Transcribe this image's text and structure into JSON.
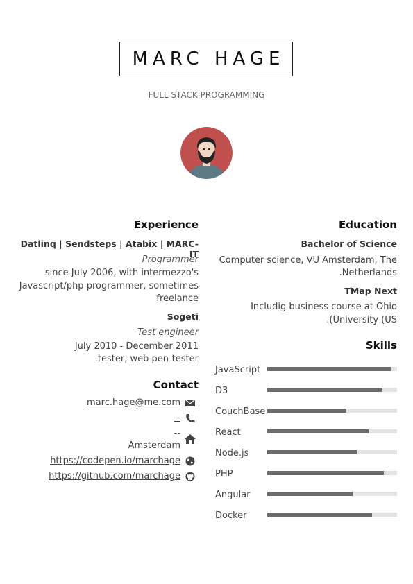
{
  "header": {
    "name": "MARC HAGE",
    "subtitle": "FULL STACK PROGRAMMING"
  },
  "experience": {
    "heading": "Experience",
    "jobs": [
      {
        "company": "Datlinq | Sendsteps | Atabix | MARC-IT",
        "role": "Programmer",
        "lines": [
          "since July 2006, with intermezzo's",
          "Javascript/php programmer, sometimes",
          "freelance"
        ]
      },
      {
        "company": "Sogeti",
        "role": "Test engineer",
        "lines": [
          "July 2010 - December 2011",
          ".tester, web pen-tester"
        ]
      }
    ]
  },
  "contact": {
    "heading": "Contact",
    "email": "marc.hage@me.com",
    "phone": "--",
    "address_line1": "--",
    "address_line2": "Amsterdam",
    "codepen": "https://codepen.io/marchage",
    "github": "https://github.com/marchage"
  },
  "education": {
    "heading": "Education",
    "items": [
      {
        "title": "Bachelor of Science",
        "lines": [
          "Computer science, VU Amsterdam, The",
          ".Netherlands"
        ]
      },
      {
        "title": "TMap Next",
        "lines": [
          "Includig business course at Ohio",
          ".(University (US"
        ]
      }
    ]
  },
  "skills": {
    "heading": "Skills",
    "items": [
      {
        "name": "JavaScript",
        "level": 0.95
      },
      {
        "name": "D3",
        "level": 0.88
      },
      {
        "name": "CouchBase",
        "level": 0.61
      },
      {
        "name": "React",
        "level": 0.78
      },
      {
        "name": "Node.js",
        "level": 0.69
      },
      {
        "name": "PHP",
        "level": 0.9
      },
      {
        "name": "Angular",
        "level": 0.66
      },
      {
        "name": "Docker",
        "level": 0.81
      }
    ]
  },
  "colors": {
    "avatar_bg": "#c0504d",
    "bar_fill": "#6b6b6b",
    "bar_track": "#e3e3e3"
  }
}
